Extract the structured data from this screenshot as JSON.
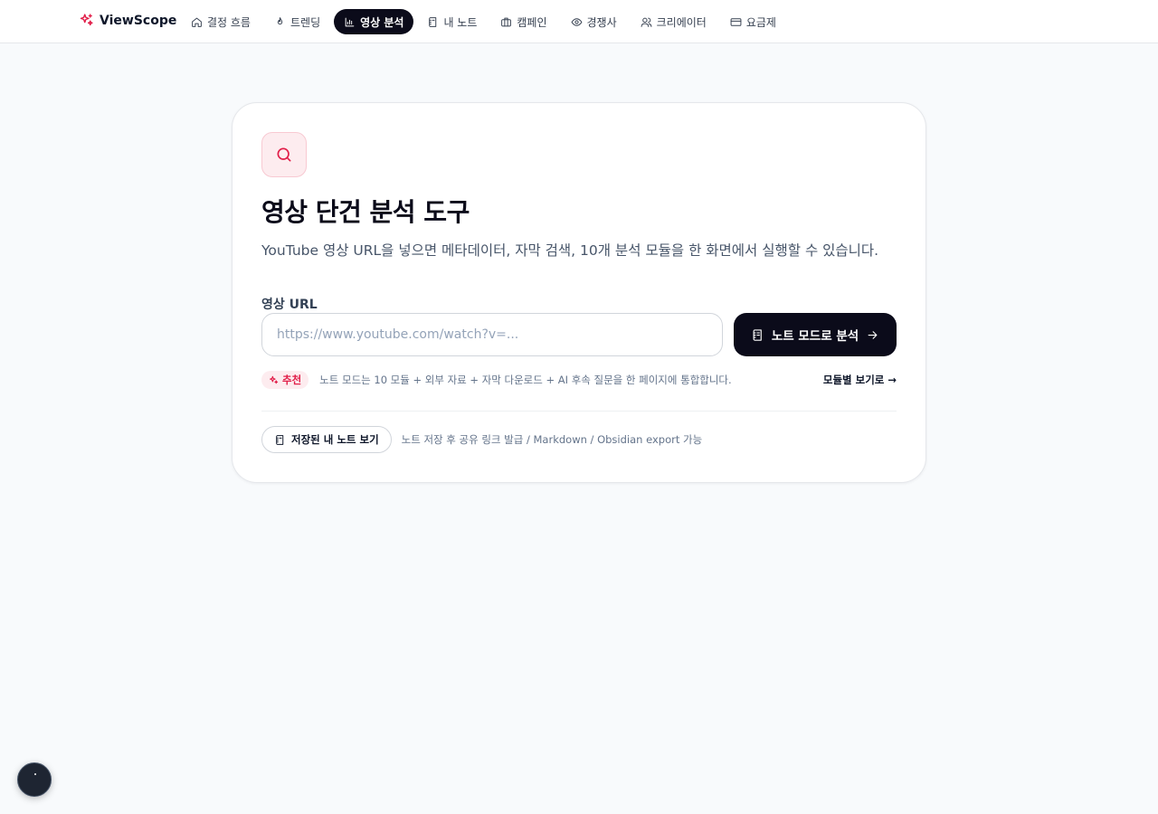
{
  "brand": {
    "name": "ViewScope",
    "accent": "#e11d48"
  },
  "nav": {
    "items": [
      {
        "label": "결정 흐름",
        "icon": "home-icon"
      },
      {
        "label": "트렌딩",
        "icon": "flame-icon"
      },
      {
        "label": "영상 분석",
        "icon": "bar-chart-icon",
        "active": true
      },
      {
        "label": "내 노트",
        "icon": "notebook-icon"
      },
      {
        "label": "캠페인",
        "icon": "briefcase-icon"
      },
      {
        "label": "경쟁사",
        "icon": "eye-icon"
      },
      {
        "label": "크리에이터",
        "icon": "users-icon"
      },
      {
        "label": "요금제",
        "icon": "credit-card-icon"
      }
    ]
  },
  "card": {
    "title": "영상 단건 분석 도구",
    "subtitle": "YouTube 영상 URL을 넣으면 메타데이터, 자막 검색, 10개 분석 모듈을 한 화면에서 실행할 수 있습니다.",
    "url_label": "영상 URL",
    "url_placeholder": "https://www.youtube.com/watch?v=...",
    "url_value": "",
    "analyze_button": "노트 모드로 분석",
    "recommend_badge": "추천",
    "recommend_text": "노트 모드는 10 모듈 + 외부 자료 + 자막 다운로드 + AI 후속 질문을 한 페이지에 통합합니다.",
    "module_link": "모듈별 보기로 →",
    "saved_notes_button": "저장된 내 노트 보기",
    "saved_notes_text": "노트 저장 후 공유 링크 발급 / Markdown / Obsidian export 가능"
  }
}
